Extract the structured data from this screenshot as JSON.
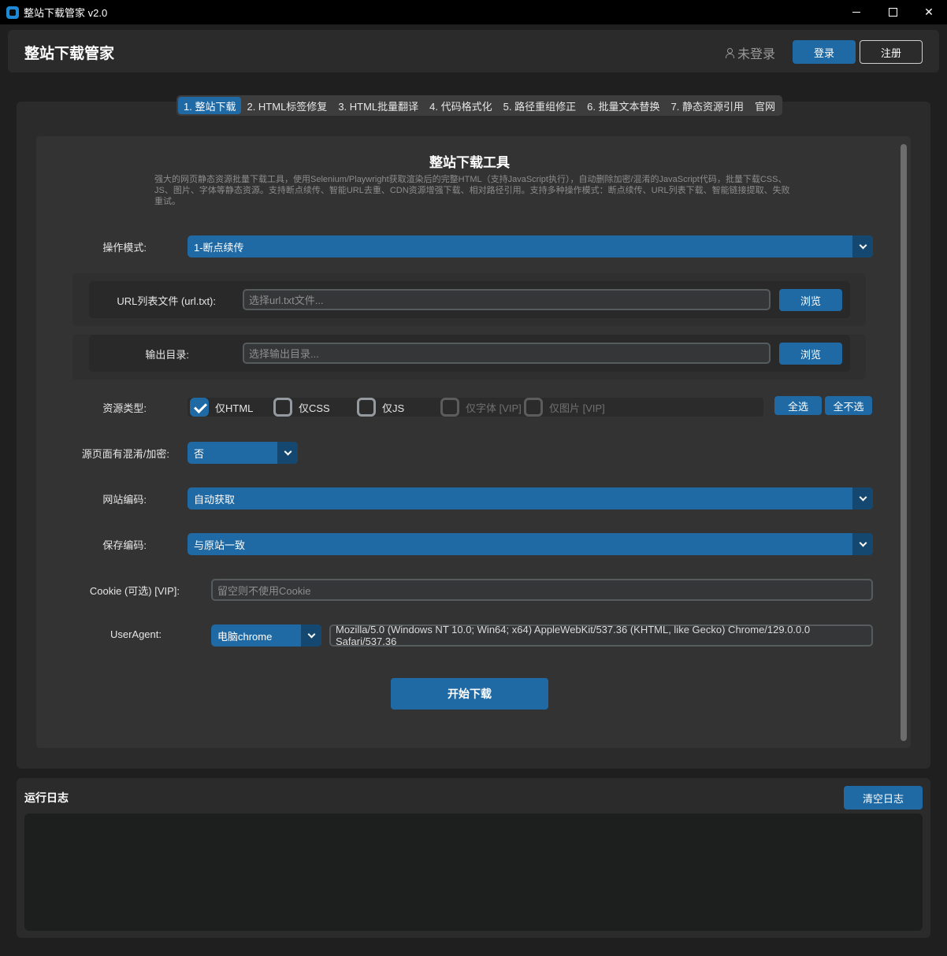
{
  "window": {
    "title": "整站下载管家 v2.0"
  },
  "header": {
    "app_title": "整站下载管家",
    "user_status": "未登录",
    "login_label": "登录",
    "register_label": "注册"
  },
  "tabs": [
    {
      "label": "1. 整站下载",
      "active": true
    },
    {
      "label": "2. HTML标签修复"
    },
    {
      "label": "3. HTML批量翻译"
    },
    {
      "label": "4. 代码格式化"
    },
    {
      "label": "5. 路径重组修正"
    },
    {
      "label": "6. 批量文本替换"
    },
    {
      "label": "7. 静态资源引用"
    },
    {
      "label": "官网"
    }
  ],
  "tool": {
    "title": "整站下载工具",
    "description": "强大的网页静态资源批量下载工具，使用Selenium/Playwright获取渲染后的完整HTML（支持JavaScript执行），自动删除加密/混淆的JavaScript代码，批量下载CSS、JS、图片、字体等静态资源。支持断点续传、智能URL去重、CDN资源增强下载、相对路径引用。支持多种操作模式：断点续传、URL列表下载、智能链接提取、失败重试。"
  },
  "form": {
    "mode_label": "操作模式:",
    "mode_value": "1-断点续传",
    "url_file_label": "URL列表文件 (url.txt):",
    "url_file_placeholder": "选择url.txt文件...",
    "output_dir_label": "输出目录:",
    "output_dir_placeholder": "选择输出目录...",
    "browse_label": "浏览",
    "resource_label": "资源类型:",
    "resource_options": [
      {
        "label": "仅HTML",
        "checked": true,
        "enabled": true
      },
      {
        "label": "仅CSS",
        "checked": false,
        "enabled": true
      },
      {
        "label": "仅JS",
        "checked": false,
        "enabled": true
      },
      {
        "label": "仅字体 [VIP]",
        "checked": false,
        "enabled": false
      },
      {
        "label": "仅图片 [VIP]",
        "checked": false,
        "enabled": false
      }
    ],
    "select_all_label": "全选",
    "select_none_label": "全不选",
    "obfuscated_label": "源页面有混淆/加密:",
    "obfuscated_value": "否",
    "site_encoding_label": "网站编码:",
    "site_encoding_value": "自动获取",
    "save_encoding_label": "保存编码:",
    "save_encoding_value": "与原站一致",
    "cookie_label": "Cookie (可选) [VIP]:",
    "cookie_placeholder": "留空则不使用Cookie",
    "useragent_label": "UserAgent:",
    "useragent_type": "电脑chrome",
    "useragent_value": "Mozilla/5.0 (Windows NT 10.0; Win64; x64) AppleWebKit/537.36 (KHTML, like Gecko) Chrome/129.0.0.0 Safari/537.36",
    "start_label": "开始下载"
  },
  "log": {
    "title": "运行日志",
    "clear_label": "清空日志"
  },
  "colors": {
    "accent": "#1f6aa5",
    "accent_dark": "#144870",
    "background": "#1f1f1f",
    "panel": "#2b2b2b"
  }
}
